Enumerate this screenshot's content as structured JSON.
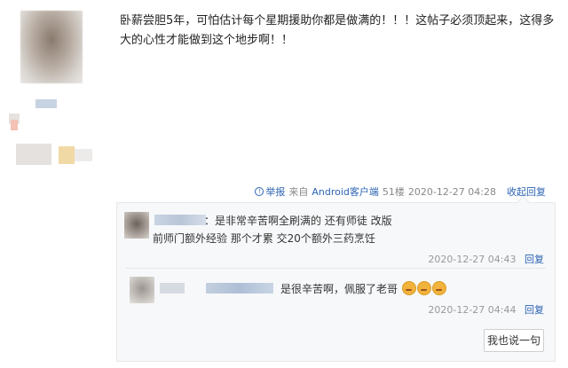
{
  "post": {
    "text": "卧薪尝胆5年，可怕估计每个星期援助你都是做满的！！！这帖子必须顶起来，这得多大的心性才能做到这个地步啊！！"
  },
  "meta": {
    "report": "举报",
    "client_prefix": "来自",
    "client": "Android客户端",
    "floor": "51楼",
    "time": "2020-12-27 04:28",
    "fold": "收起回复"
  },
  "replies": [
    {
      "text": "：是非常辛苦啊全刷满的 还有师徒 改版前师门额外经验 那个才累 交20个额外三药烹饪",
      "time": "2020-12-27 04:43",
      "reply": "回复"
    },
    {
      "text": "是很辛苦啊，佩服了老哥",
      "time": "2020-12-27 04:44",
      "reply": "回复"
    }
  ],
  "say_button": "我也说一句"
}
